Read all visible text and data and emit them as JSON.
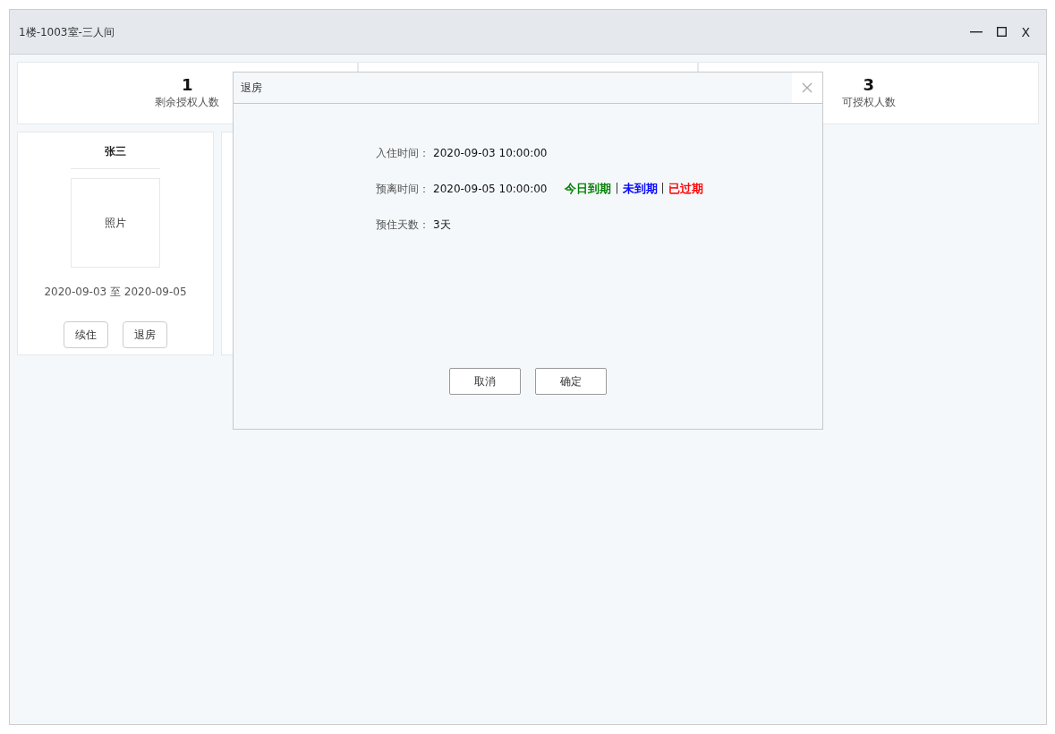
{
  "window": {
    "title": "1楼-1003室-三人间",
    "controls": [
      {
        "kind": "minimize"
      },
      {
        "kind": "maximize"
      },
      {
        "kind": "close",
        "label": "X"
      }
    ]
  },
  "stats": [
    {
      "value": "1",
      "label": "剩余授权人数"
    },
    {
      "value": "3",
      "label": "可授权人数"
    }
  ],
  "guests": [
    {
      "name": "张三",
      "photo": "照片",
      "period": "2020-09-03 至 2020-09-05",
      "buttons": [
        "续住",
        "退房"
      ]
    }
  ],
  "dialog": {
    "title": "退房",
    "fields": [
      {
        "label": "入住时间：",
        "value": "2020-09-03 10:00:00"
      },
      {
        "label": "预离时间：",
        "value": "2020-09-05 10:00:00",
        "legend": [
          {
            "label": "今日到期",
            "color": "#008000"
          },
          {
            "label": "未到期",
            "color": "#0000ff"
          },
          {
            "label": "已过期",
            "color": "#ff0000"
          }
        ],
        "separator": "|"
      },
      {
        "label": "预住天数：",
        "value": "3天"
      }
    ],
    "buttons": [
      "取消",
      "确定"
    ]
  }
}
